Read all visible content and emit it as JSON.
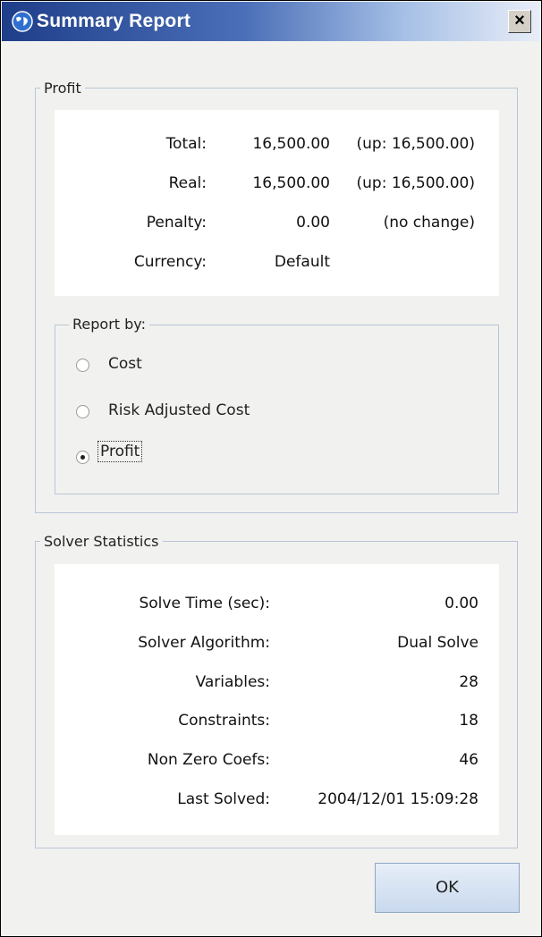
{
  "window": {
    "title": "Summary Report",
    "close_glyph": "×"
  },
  "profit": {
    "legend": "Profit",
    "rows": [
      {
        "label": "Total:",
        "value": "16,500.00",
        "note": "(up: 16,500.00)"
      },
      {
        "label": "Real:",
        "value": "16,500.00",
        "note": "(up: 16,500.00)"
      },
      {
        "label": "Penalty:",
        "value": "0.00",
        "note": "(no change)"
      },
      {
        "label": "Currency:",
        "value": "Default",
        "note": ""
      }
    ]
  },
  "report_by": {
    "legend": "Report by:",
    "options": [
      {
        "label": "Cost",
        "selected": false
      },
      {
        "label": "Risk Adjusted Cost",
        "selected": false
      },
      {
        "label": "Profit",
        "selected": true
      }
    ]
  },
  "solver": {
    "legend": "Solver Statistics",
    "rows": [
      {
        "label": "Solve Time (sec):",
        "value": "0.00"
      },
      {
        "label": "Solver Algorithm:",
        "value": "Dual Solve"
      },
      {
        "label": "Variables:",
        "value": "28"
      },
      {
        "label": "Constraints:",
        "value": "18"
      },
      {
        "label": "Non Zero Coefs:",
        "value": "46"
      },
      {
        "label": "Last Solved:",
        "value": "2004/12/01 15:09:28"
      }
    ]
  },
  "buttons": {
    "ok_label": "OK"
  },
  "icons": {
    "app": "globe-icon",
    "close": "close-icon"
  },
  "colors": {
    "title_dark": "#1f3e8a",
    "group_border": "#b9c6d8",
    "dialog_bg": "#f1f1ef"
  }
}
